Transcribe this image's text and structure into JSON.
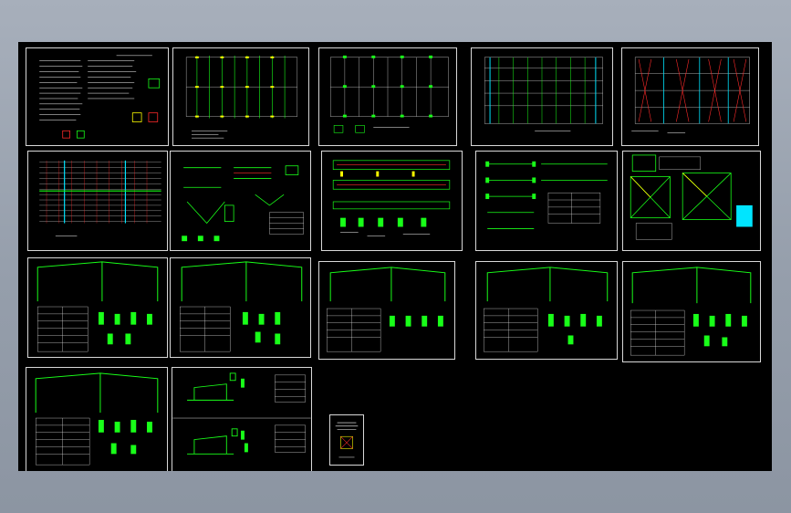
{
  "app": {
    "title": "",
    "background_color": "#959eab",
    "canvas_color": "#000000"
  },
  "drawing": {
    "sheet_count": 19,
    "sheets": [
      {
        "id": "s1",
        "kind": "general-notes"
      },
      {
        "id": "s2",
        "kind": "column-layout-plan"
      },
      {
        "id": "s3",
        "kind": "anchor-bolt-plan"
      },
      {
        "id": "s4",
        "kind": "roof-purlin-plan"
      },
      {
        "id": "s5",
        "kind": "roof-bracing-plan"
      },
      {
        "id": "s6",
        "kind": "wall-girt-elevation"
      },
      {
        "id": "s7",
        "kind": "connection-details"
      },
      {
        "id": "s8",
        "kind": "crane-beam-elevation"
      },
      {
        "id": "s9",
        "kind": "beam-details"
      },
      {
        "id": "s10",
        "kind": "bracing-details"
      },
      {
        "id": "s11",
        "kind": "portal-frame-1"
      },
      {
        "id": "s12",
        "kind": "portal-frame-2"
      },
      {
        "id": "s13",
        "kind": "portal-frame-3"
      },
      {
        "id": "s14",
        "kind": "portal-frame-4"
      },
      {
        "id": "s15",
        "kind": "portal-frame-5"
      },
      {
        "id": "s16",
        "kind": "portal-frame-6"
      },
      {
        "id": "s17",
        "kind": "frame-section-details"
      },
      {
        "id": "s18",
        "kind": "cover-sheet"
      }
    ]
  },
  "colors": {
    "sheet_border": "#d8d8d8",
    "steel": "#19ff19",
    "grid": "#d8d8d8",
    "bracing": "#ff2a2a",
    "axis": "#00e5ff",
    "text": "#ffffff",
    "highlight": "#ffff00"
  }
}
